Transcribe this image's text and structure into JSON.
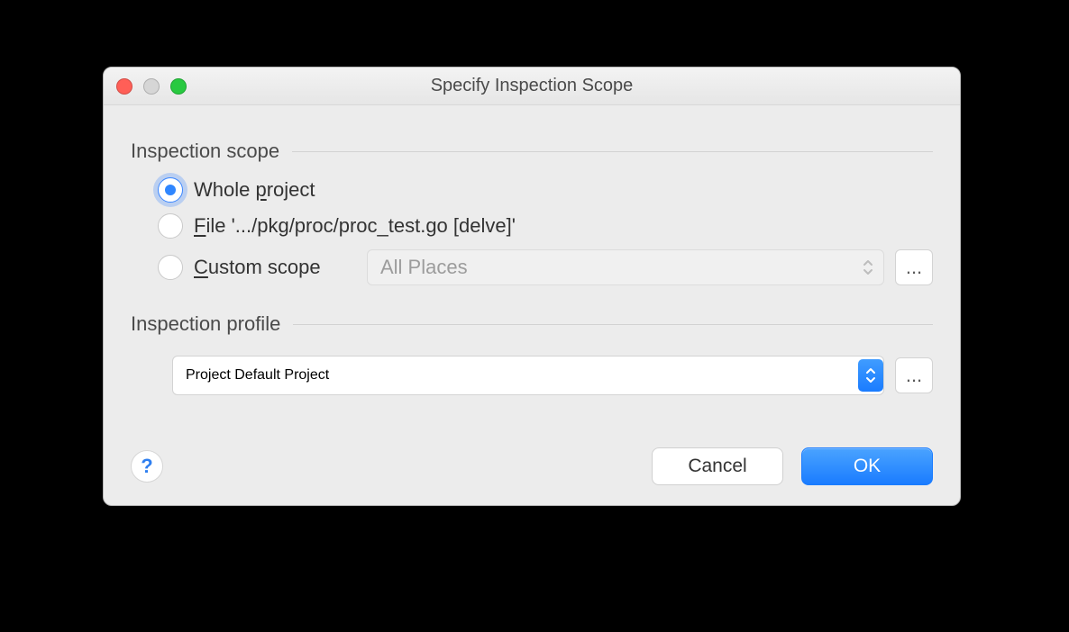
{
  "window": {
    "title": "Specify Inspection Scope"
  },
  "scope": {
    "group_label": "Inspection scope",
    "options": {
      "whole_project": {
        "prefix": "Whole ",
        "mnemonic": "p",
        "suffix": "roject",
        "selected": true
      },
      "file": {
        "mnemonic": "F",
        "suffix": "ile '.../pkg/proc/proc_test.go [delve]'",
        "selected": false
      },
      "custom": {
        "mnemonic": "C",
        "suffix": "ustom scope",
        "selected": false,
        "combo_value": "All Places",
        "combo_enabled": false
      }
    }
  },
  "profile": {
    "group_label": "Inspection profile",
    "selected": "Project Default",
    "secondary": "Project"
  },
  "buttons": {
    "help": "?",
    "cancel": "Cancel",
    "ok": "OK",
    "ellipsis": "..."
  }
}
